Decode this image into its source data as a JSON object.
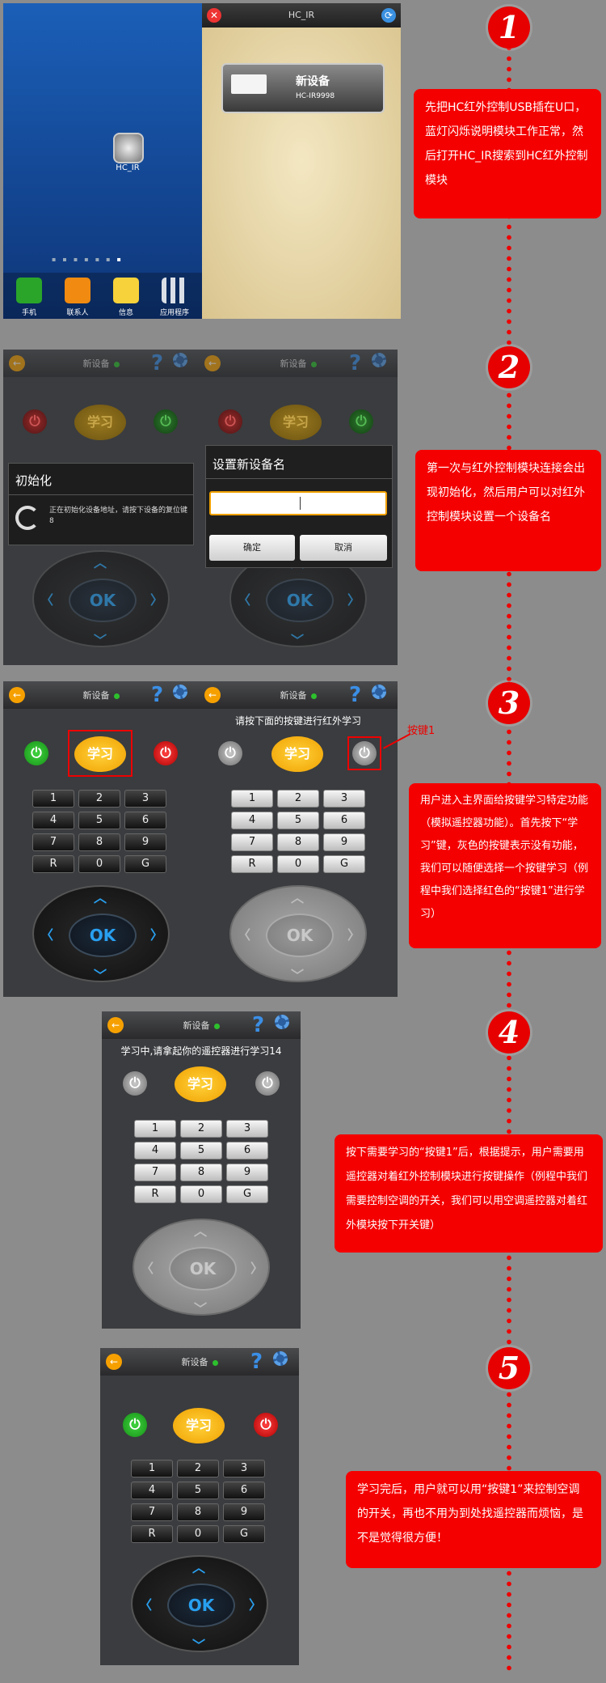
{
  "timeline": {
    "steps": [
      "1",
      "2",
      "3",
      "4",
      "5"
    ]
  },
  "notes": {
    "n1": "先把HC红外控制USB插在U口，蓝灯闪烁说明模块工作正常，然后打开HC_IR搜索到HC红外控制模块",
    "n2": "第一次与红外控制模块连接会出现初始化，然后用户可以对红外控制模块设置一个设备名",
    "n3": "用户进入主界面给按键学习特定功能（模拟遥控器功能）。首先按下“学习”键，灰色的按键表示没有功能，我们可以随便选择一个按键学习（例程中我们选择红色的“按键1”进行学习）",
    "n4": "按下需要学习的“按键1”后，根据提示，用户需要用遥控器对着红外控制模块进行按键操作（例程中我们需要控制空调的开关，我们可以用空调遥控器对着红外模块按下开关键）",
    "n5": "学习完后，用户就可以用“按键1”来控制空调的开关，再也不用为到处找遥控器而烦恼，是不是觉得很方便！"
  },
  "home": {
    "app_icon_label": "HC_IR",
    "dock": [
      "手机",
      "联系人",
      "信息",
      "应用程序"
    ]
  },
  "search": {
    "title": "HC_IR",
    "device_name": "新设备",
    "device_id": "HC-IR9998"
  },
  "remote": {
    "device": "新设备",
    "learn_label": "学习",
    "ok_label": "OK",
    "keys": [
      "1",
      "2",
      "3",
      "4",
      "5",
      "6",
      "7",
      "8",
      "9",
      "R",
      "0",
      "G"
    ]
  },
  "init_dialog": {
    "title": "初始化",
    "message": "正在初始化设备地址，请按下设备的复位键 8"
  },
  "name_dialog": {
    "title": "设置新设备名",
    "confirm": "确定",
    "cancel": "取消"
  },
  "step3": {
    "prompt": "请按下面的按键进行红外学习",
    "callout": "按键1"
  },
  "step4": {
    "prompt": "学习中,请拿起你的遥控器进行学习14"
  },
  "colors": {
    "accent_red": "#f40000",
    "learn_yellow": "#f0a000",
    "ok_blue": "#28a0f0"
  }
}
